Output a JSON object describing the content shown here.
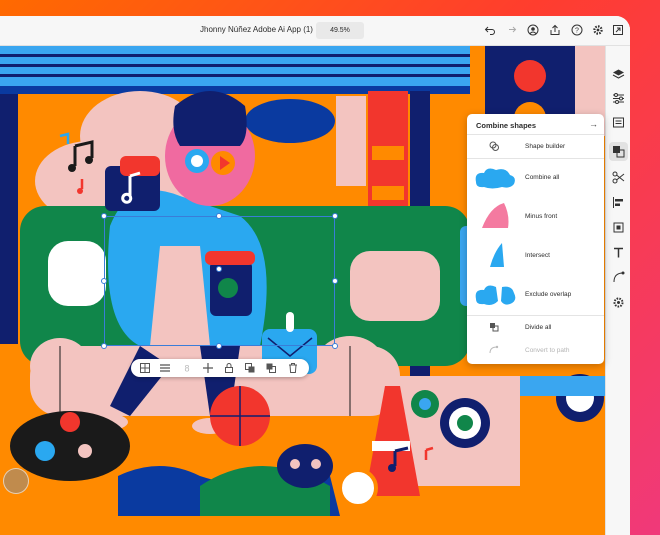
{
  "header": {
    "document_title": "Jhonny Núñez Adobe Ai App (1)",
    "zoom": "49.5%"
  },
  "toolbar_icons": [
    "undo-icon",
    "redo-icon",
    "collaborate-icon",
    "share-icon",
    "help-icon",
    "settings-icon",
    "fullscreen-icon"
  ],
  "right_rail": {
    "icons": [
      "layers-icon",
      "properties-icon",
      "libraries-icon",
      "combine-shapes-icon",
      "scissors-icon",
      "align-icon",
      "transform-icon",
      "text-icon",
      "path-icon",
      "settings-gear-icon"
    ],
    "active": "combine-shapes-icon"
  },
  "combine_panel": {
    "title": "Combine shapes",
    "shape_builder_label": "Shape builder",
    "operations": [
      {
        "label": "Combine all",
        "color": "#2aa8f0"
      },
      {
        "label": "Minus front",
        "color": "#f47aa0"
      },
      {
        "label": "Intersect",
        "color": "#2aa8f0"
      },
      {
        "label": "Exclude overlap",
        "color": "#2aa8f0"
      }
    ],
    "divide_all_label": "Divide all",
    "convert_to_path_label": "Convert to path"
  },
  "context_bar": {
    "icons": [
      "pattern-icon",
      "distribute-icon",
      "lock-count-icon",
      "move-icon",
      "lock-icon",
      "arrange-front-icon",
      "duplicate-icon",
      "delete-icon"
    ]
  },
  "colors": {
    "canvas_orange": "#ff8a00",
    "accent_blue": "#3a7dd8",
    "navy": "#101f6e",
    "red": "#f2362d",
    "pink": "#f3c4c0",
    "green": "#10864a"
  }
}
